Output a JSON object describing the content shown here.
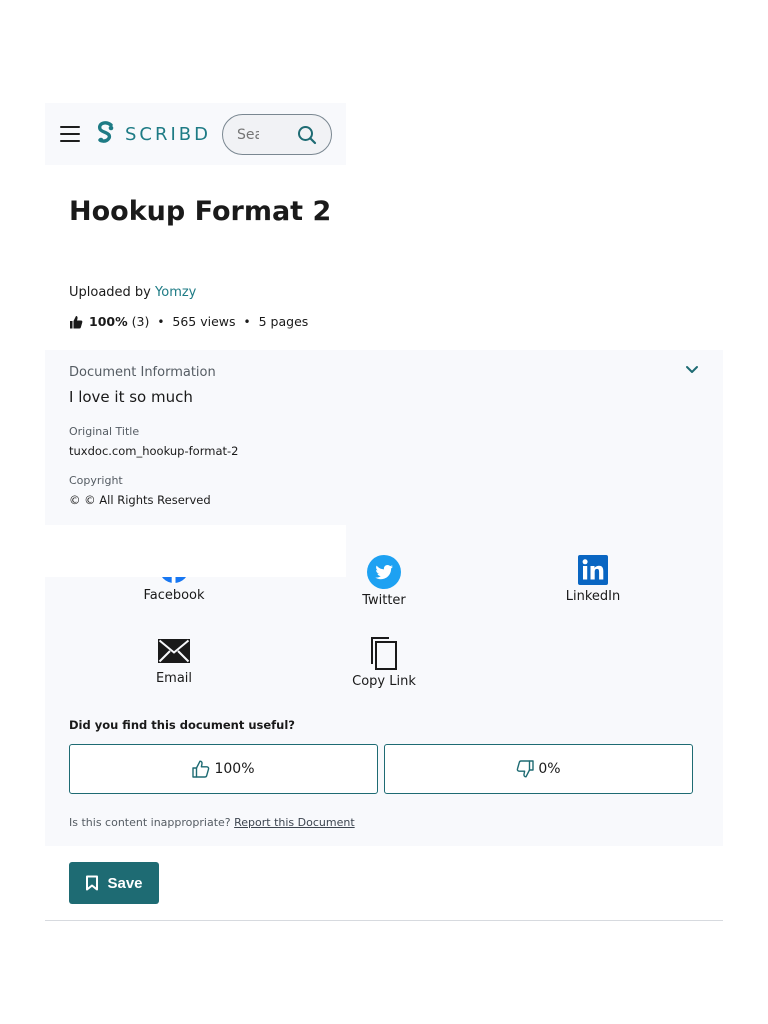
{
  "header": {
    "logo_text": "SCRIBD",
    "search_placeholder": "Search",
    "brand_color": "#1e7b85"
  },
  "document": {
    "title": "Hookup Format 2",
    "uploaded_prefix": "Uploaded by",
    "uploader": "Yomzy",
    "rating_percent": "100%",
    "rating_count": "(3)",
    "views": "565 views",
    "pages": "5 pages"
  },
  "info": {
    "heading": "Document Information",
    "description": "I love it so much",
    "original_title_label": "Original Title",
    "original_title": "tuxdoc.com_hookup-format-2",
    "copyright_label": "Copyright",
    "copyright": "© © All Rights Reserved"
  },
  "share": {
    "facebook": "Facebook",
    "twitter": "Twitter",
    "linkedin": "LinkedIn",
    "email": "Email",
    "copy_link": "Copy Link"
  },
  "feedback": {
    "question": "Did you find this document useful?",
    "upvote": "100%",
    "downvote": "0%",
    "inappropriate": "Is this content inappropriate?",
    "report": "Report this Document"
  },
  "actions": {
    "save": "Save"
  }
}
